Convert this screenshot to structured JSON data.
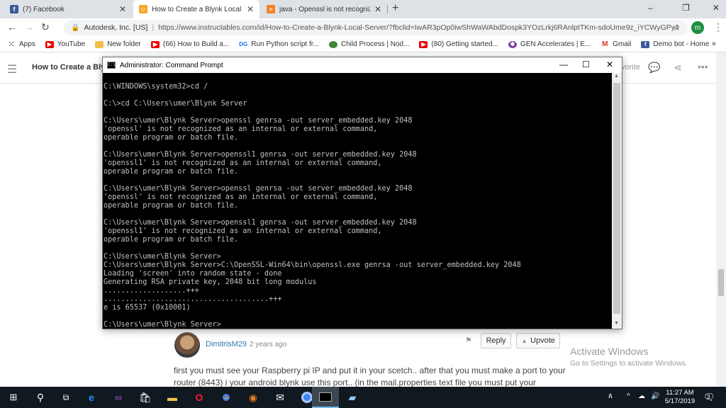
{
  "browser": {
    "tabs": [
      {
        "title": "(7) Facebook",
        "icon": "facebook-icon",
        "color": "#3b5998",
        "active": false
      },
      {
        "title": "How to Create a Blynk Local Serv",
        "icon": "instructables-icon",
        "color": "#f5a623",
        "active": true
      },
      {
        "title": "java - Openssl is not recognized",
        "icon": "stackoverflow-icon",
        "color": "#f48024",
        "active": false
      }
    ],
    "newtab_label": "+",
    "window_controls": [
      "–",
      "❐",
      "✕"
    ],
    "omnibox": {
      "org": "Autodesk, Inc. [US]",
      "url": "https://www.instructables.com/id/How-to-Create-a-Blynk-Local-Server/?fbclid=IwAR3pOp0iwShWaWAbdDospk3YOzLrkj6RAnlptTKm-sdoUme9z_iYCWyGPy4"
    },
    "profile_initial": "m",
    "bookmarks": [
      {
        "label": "Apps",
        "icon": "apps-icon",
        "color": "#e53935"
      },
      {
        "label": "YouTube",
        "icon": "youtube-icon",
        "color": "#e00"
      },
      {
        "label": "New folder",
        "icon": "folder-icon",
        "color": "#f2c04a"
      },
      {
        "label": "(66) How to Build a...",
        "icon": "youtube-icon",
        "color": "#e00"
      },
      {
        "label": "Run Python script fr...",
        "icon": "dg-icon",
        "color": "#1a73e8"
      },
      {
        "label": "Child Process | Nod...",
        "icon": "node-icon",
        "color": "#3c873a"
      },
      {
        "label": "(80) Getting started...",
        "icon": "youtube-icon",
        "color": "#e00"
      },
      {
        "label": "GEN Accelerates | E...",
        "icon": "gen-icon",
        "color": "#7b3fa0"
      },
      {
        "label": "Gmail",
        "icon": "gmail-icon",
        "color": "#d93025"
      },
      {
        "label": "Demo bot - Home",
        "icon": "facebook-icon",
        "color": "#3b5998"
      }
    ],
    "bookmarks_more": "»"
  },
  "page": {
    "title": "How to Create a Bly",
    "favorite_label": "vorite",
    "comment": {
      "author": "DimitrisM29",
      "time": "2 years ago",
      "reply_label": "Reply",
      "upvote_label": "Upvote",
      "text": "first you must see your Raspberry pi IP and put it in your scetch.. after that you must make a port to your router (8443) i your android blynk use this port.. (in the mail.properties text file you must put your"
    },
    "watermark": {
      "title": "Activate Windows",
      "subtitle": "Go to Settings to activate Windows."
    }
  },
  "cmd": {
    "title": "Administrator: Command Prompt",
    "lines": [
      "",
      "C:\\WINDOWS\\system32>cd /",
      "",
      "C:\\>cd C:\\Users\\umer\\Blynk Server",
      "",
      "C:\\Users\\umer\\Blynk Server>openssl genrsa -out server_embedded.key 2048",
      "'openssl' is not recognized as an internal or external command,",
      "operable program or batch file.",
      "",
      "C:\\Users\\umer\\Blynk Server>openssl1 genrsa -out server_embedded.key 2048",
      "'openssl1' is not recognized as an internal or external command,",
      "operable program or batch file.",
      "",
      "C:\\Users\\umer\\Blynk Server>openssl genrsa -out server_embedded.key 2048",
      "'openssl' is not recognized as an internal or external command,",
      "operable program or batch file.",
      "",
      "C:\\Users\\umer\\Blynk Server>openssl1 genrsa -out server_embedded.key 2048",
      "'openssl1' is not recognized as an internal or external command,",
      "operable program or batch file.",
      "",
      "C:\\Users\\umer\\Blynk Server>",
      "C:\\Users\\umer\\Blynk Server>C:\\OpenSSL-Win64\\bin\\openssl.exe genrsa -out server_embedded.key 2048",
      "Loading 'screen' into random state - done",
      "Generating RSA private key, 2048 bit long modulus",
      "...................+++",
      "......................................+++",
      "e is 65537 (0x10001)",
      "",
      "C:\\Users\\umer\\Blynk Server>"
    ]
  },
  "taskbar": {
    "clock_time": "11:27 AM",
    "clock_date": "5/17/2019",
    "notification_count": "3"
  }
}
